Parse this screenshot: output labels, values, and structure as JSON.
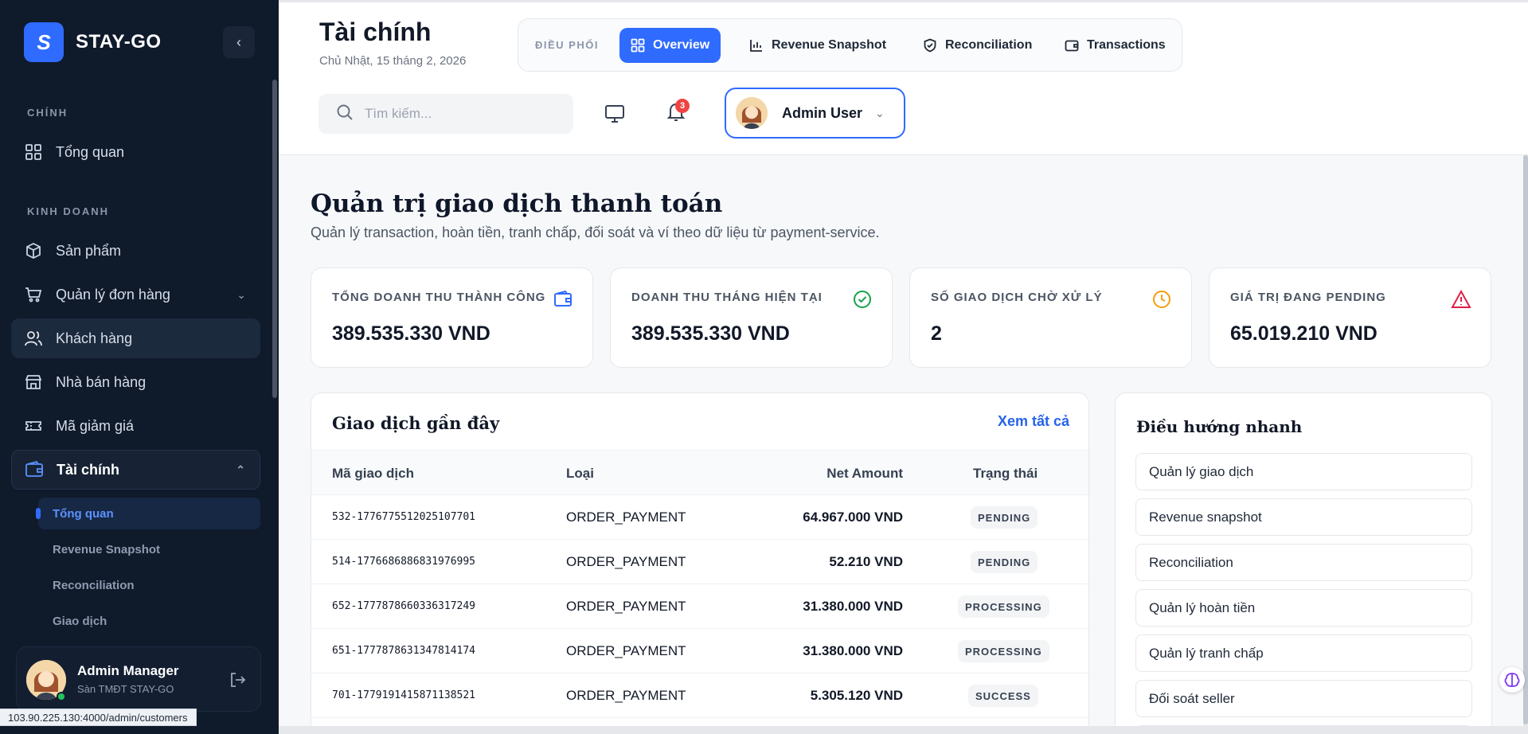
{
  "brand": {
    "name": "STAY-GO",
    "logo_letter": "S",
    "accent": "#2f6bff"
  },
  "sidebar": {
    "sections": [
      "CHÍNH",
      "KINH DOANH"
    ],
    "items": [
      {
        "label": "Tổng quan",
        "icon": "grid-icon"
      },
      {
        "label": "Sản phẩm",
        "icon": "box-icon"
      },
      {
        "label": "Quản lý đơn hàng",
        "icon": "cart-icon"
      },
      {
        "label": "Khách hàng",
        "icon": "users-icon"
      },
      {
        "label": "Nhà bán hàng",
        "icon": "store-icon"
      },
      {
        "label": "Mã giảm giá",
        "icon": "ticket-icon"
      },
      {
        "label": "Tài chính",
        "icon": "wallet-icon"
      }
    ],
    "finance_sub": [
      "Tổng quan",
      "Revenue Snapshot",
      "Reconciliation",
      "Giao dịch"
    ],
    "user": {
      "name": "Admin Manager",
      "org": "Sàn TMĐT STAY-GO"
    }
  },
  "status_url": "103.90.225.130:4000/admin/customers",
  "header": {
    "title": "Tài chính",
    "date": "Chủ Nhật, 15 tháng 2, 2026",
    "tabs_label": "ĐIỀU PHỐI",
    "tabs": [
      "Overview",
      "Revenue Snapshot",
      "Reconciliation",
      "Transactions"
    ],
    "search_placeholder": "Tìm kiếm...",
    "notification_count": "3",
    "user_name": "Admin User"
  },
  "main": {
    "title": "Quản trị giao dịch thanh toán",
    "subtitle": "Quản lý transaction, hoàn tiền, tranh chấp, đối soát và ví theo dữ liệu từ payment-service.",
    "kpis": [
      {
        "label": "TỔNG DOANH THU THÀNH CÔNG",
        "value": "389.535.330 VND",
        "icon": "wallet-icon",
        "color": "#2f6bff"
      },
      {
        "label": "DOANH THU THÁNG HIỆN TẠI",
        "value": "389.535.330 VND",
        "icon": "check-circle-icon",
        "color": "#16a34a"
      },
      {
        "label": "SỐ GIAO DỊCH CHỜ XỬ LÝ",
        "value": "2",
        "icon": "clock-icon",
        "color": "#f59e0b"
      },
      {
        "label": "GIÁ TRỊ ĐANG PENDING",
        "value": "65.019.210 VND",
        "icon": "alert-triangle-icon",
        "color": "#e11d48"
      }
    ],
    "transactions": {
      "title": "Giao dịch gần đây",
      "view_all": "Xem tất cả",
      "columns": [
        "Mã giao dịch",
        "Loại",
        "Net Amount",
        "Trạng thái"
      ],
      "rows": [
        {
          "code": "532-1776775512025107701",
          "type": "ORDER_PAYMENT",
          "amount": "64.967.000 VND",
          "status": "PENDING"
        },
        {
          "code": "514-1776686886831976995",
          "type": "ORDER_PAYMENT",
          "amount": "52.210 VND",
          "status": "PENDING"
        },
        {
          "code": "652-1777878660336317249",
          "type": "ORDER_PAYMENT",
          "amount": "31.380.000 VND",
          "status": "PROCESSING"
        },
        {
          "code": "651-1777878631347814174",
          "type": "ORDER_PAYMENT",
          "amount": "31.380.000 VND",
          "status": "PROCESSING"
        },
        {
          "code": "701-1779191415871138521",
          "type": "ORDER_PAYMENT",
          "amount": "5.305.120 VND",
          "status": "SUCCESS"
        }
      ]
    },
    "quick_nav": {
      "title": "Điều hướng nhanh",
      "items": [
        "Quản lý giao dịch",
        "Revenue snapshot",
        "Reconciliation",
        "Quản lý hoàn tiền",
        "Quản lý tranh chấp",
        "Đối soát seller"
      ]
    }
  }
}
